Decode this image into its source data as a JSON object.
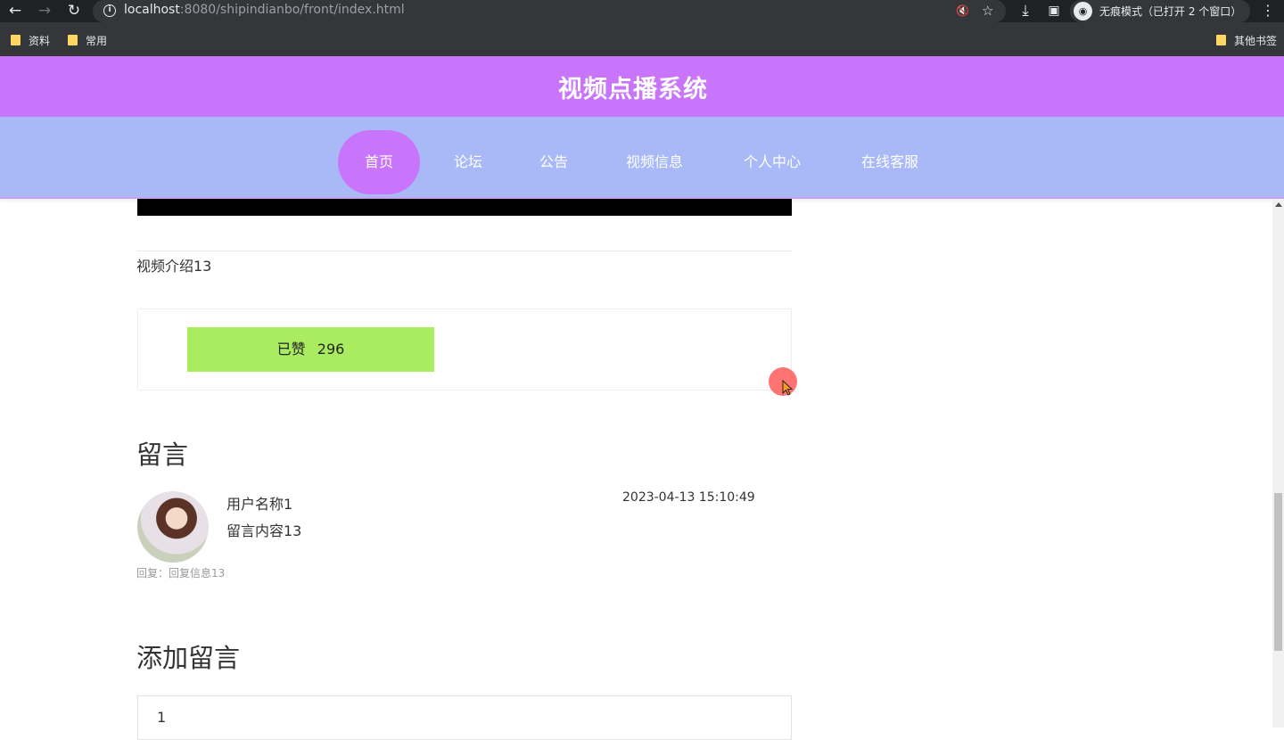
{
  "browser": {
    "url_host": "localhost",
    "url_rest": ":8080/shipindianbo/front/index.html",
    "incognito_label": "无痕模式（已打开 2 个窗口）",
    "bookmarks": [
      "资料",
      "常用"
    ],
    "other_bookmarks": "其他书签"
  },
  "site": {
    "title": "视频点播系统",
    "nav": [
      "首页",
      "论坛",
      "公告",
      "视频信息",
      "个人中心",
      "在线客服"
    ],
    "active_nav": "首页"
  },
  "video": {
    "intro": "视频介绍13",
    "like_label": "已赞",
    "like_count": "296"
  },
  "comments": {
    "title": "留言",
    "items": [
      {
        "username": "用户名称1",
        "content": "留言内容13",
        "time": "2023-04-13 15:10:49",
        "reply": "回复：回复信息13"
      }
    ]
  },
  "add_comment": {
    "title": "添加留言",
    "input_value": "1"
  }
}
